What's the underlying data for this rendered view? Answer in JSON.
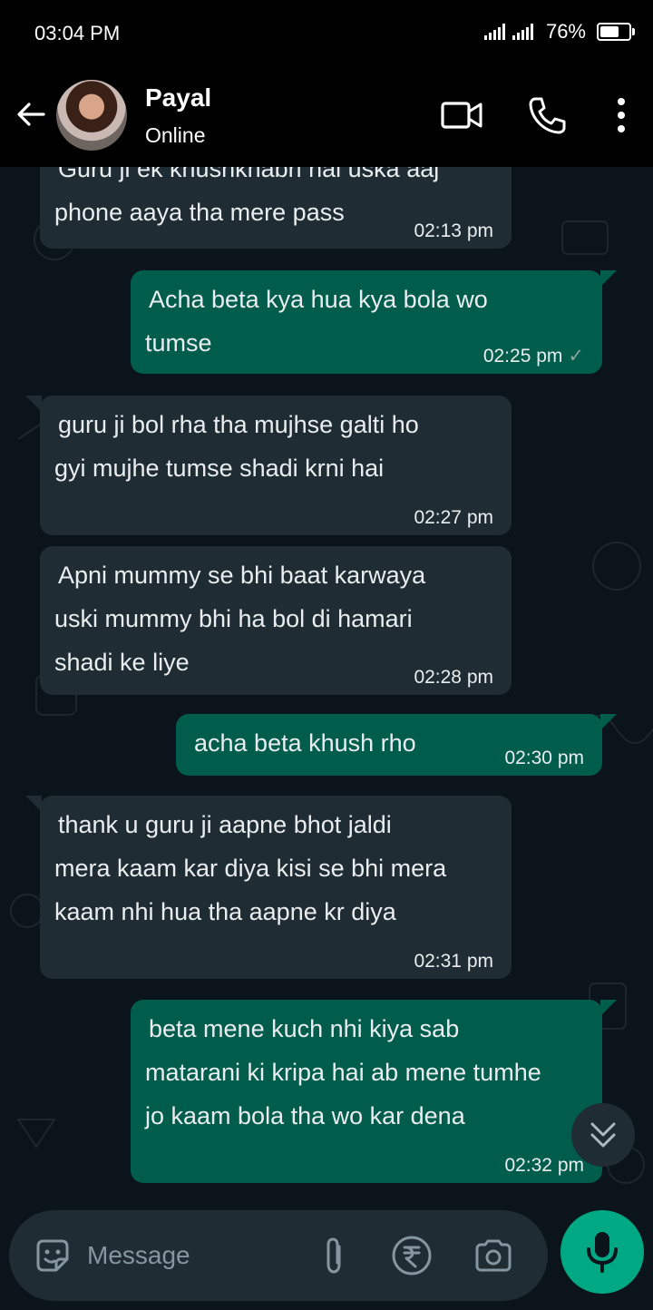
{
  "status": {
    "time": "03:04 PM",
    "battery": "76%",
    "battery_level": 0.76
  },
  "contact": {
    "name": "Payal",
    "presence": "Online"
  },
  "messages": [
    {
      "dir": "in",
      "lines": [
        "Guru ji ek khushkhabri hai uska aaj",
        "phone aaya tha mere pass"
      ],
      "time": "02:13 pm"
    },
    {
      "dir": "out",
      "lines": [
        "Acha beta kya hua kya bola wo",
        "tumse"
      ],
      "time": "02:25 pm"
    },
    {
      "dir": "in",
      "lines": [
        "guru ji bol rha tha mujhse galti ho",
        "gyi mujhe tumse shadi krni hai"
      ],
      "time": "02:27 pm"
    },
    {
      "dir": "in",
      "lines": [
        "Apni mummy se bhi baat karwaya",
        "uski mummy bhi ha bol di hamari",
        "shadi ke liye"
      ],
      "time": "02:28 pm"
    },
    {
      "dir": "out",
      "lines": [
        "acha beta khush rho"
      ],
      "time": "02:30 pm"
    },
    {
      "dir": "in",
      "lines": [
        "thank u guru ji aapne bhot jaldi",
        "mera kaam kar diya kisi se bhi mera",
        "kaam nhi hua tha aapne kr diya"
      ],
      "time": "02:31 pm"
    },
    {
      "dir": "out",
      "lines": [
        "beta mene kuch nhi kiya sab",
        "matarani ki kripa hai ab mene tumhe",
        "jo kaam bola tha wo kar dena"
      ],
      "time": "02:32 pm"
    }
  ],
  "composer": {
    "placeholder": "Message"
  },
  "icons": {
    "back": "back-arrow-icon",
    "video": "video-call-icon",
    "call": "phone-icon",
    "menu": "more-vert-icon",
    "emoji": "sticker-icon",
    "attach": "paperclip-icon",
    "payment": "rupee-icon",
    "camera": "camera-icon",
    "mic": "mic-icon",
    "scroll": "chevrons-down-icon",
    "read": "check-icon"
  },
  "colors": {
    "incoming": "#1f2c33",
    "outgoing": "#005c4b",
    "accent": "#00a884",
    "background": "#0b141a"
  }
}
